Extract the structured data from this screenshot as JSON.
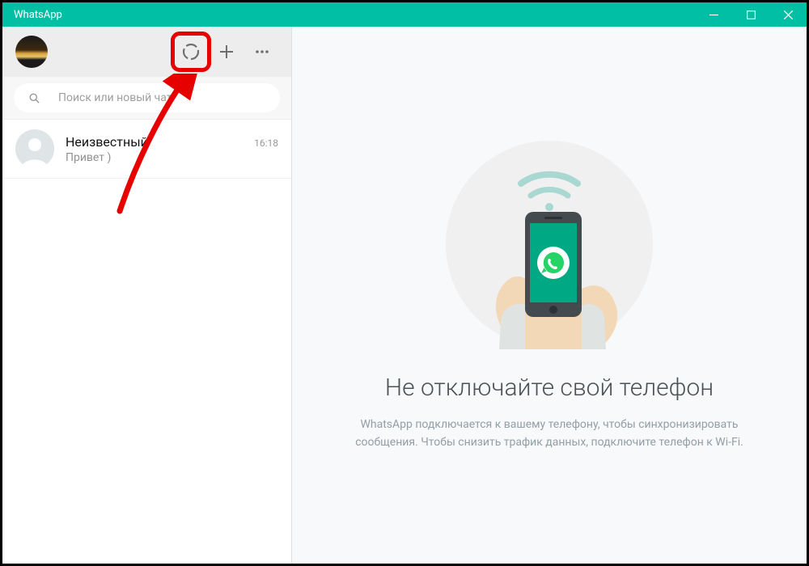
{
  "window": {
    "title": "WhatsApp"
  },
  "header": {
    "icons": {
      "status": "status-icon",
      "new_chat": "plus-icon",
      "menu": "more-icon"
    }
  },
  "search": {
    "placeholder": "Поиск или новый чат"
  },
  "chats": [
    {
      "name": "Неизвестный",
      "preview": "Привет )",
      "time": "16:18"
    }
  ],
  "empty": {
    "title": "Не отключайте свой телефон",
    "line1": "WhatsApp подключается к вашему телефону, чтобы синхронизировать",
    "line2": "сообщения. Чтобы снизить трафик данных, подключите телефон к Wi-Fi."
  },
  "colors": {
    "accent": "#00bfa5",
    "phone": "#00a884",
    "highlight": "#e60000"
  }
}
